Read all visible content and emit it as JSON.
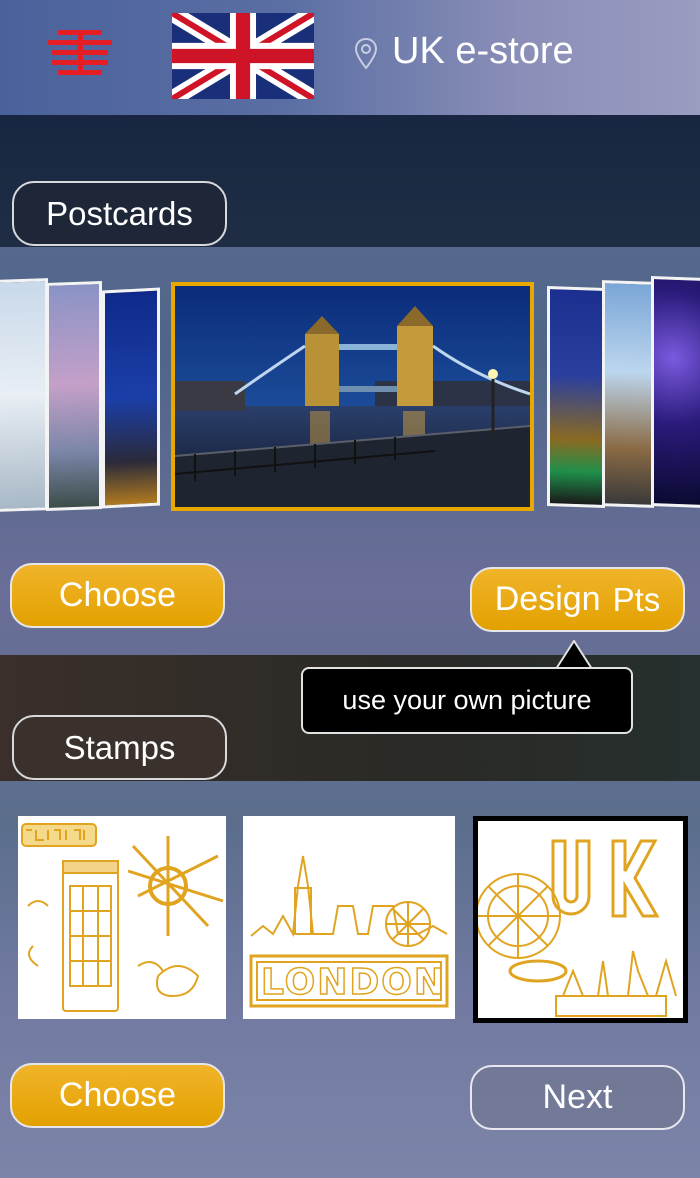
{
  "header": {
    "store_label": "UK e-store",
    "menu_icon": "menu-icon",
    "flag_icon": "union-jack-flag",
    "location_icon": "map-pin-icon"
  },
  "postcards": {
    "section_label": "Postcards",
    "choose_label": "Choose",
    "design_label": "Design",
    "design_suffix": "Pts",
    "tooltip": "use your own picture"
  },
  "stamps": {
    "section_label": "Stamps",
    "choose_label": "Choose",
    "next_label": "Next",
    "items": [
      {
        "id": "stamp-telephone-box",
        "selected": false
      },
      {
        "id": "stamp-london-skyline",
        "selected": false
      },
      {
        "id": "stamp-uk-eye",
        "selected": true
      }
    ]
  },
  "colors": {
    "accent_yellow": "#e9a800",
    "menu_red": "#e51e25",
    "stamp_line": "#e0a420"
  }
}
